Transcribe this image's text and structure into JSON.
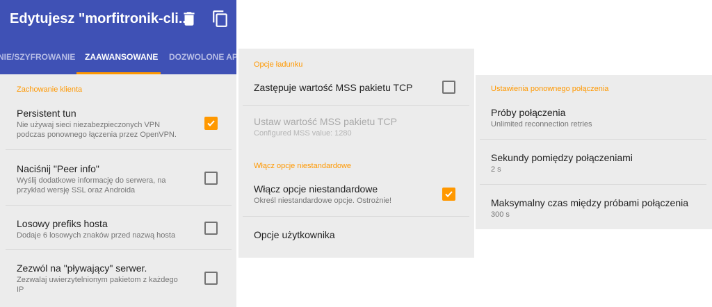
{
  "colors": {
    "primary": "#3f51b5",
    "accent": "#ff9800"
  },
  "panel1": {
    "app_title": "Edytujesz \"morfitronik-cli...",
    "icons": {
      "delete": "trash-icon",
      "duplicate": "copy-icon"
    },
    "tabs": [
      {
        "label": "NIE/SZYFROWANIE",
        "active": false
      },
      {
        "label": "ZAAWANSOWANE",
        "active": true
      },
      {
        "label": "DOZWOLONE APLIKACJE",
        "active": false
      }
    ],
    "section": "Zachowanie klienta",
    "items": [
      {
        "title": "Persistent tun",
        "summary": "Nie używaj sieci niezabezpieczonych VPN\npodczas ponownego łączenia przez OpenVPN.",
        "checked": true
      },
      {
        "title": "Naciśnij \"Peer info\"",
        "summary": "Wyślij dodatkowe informację do serwera, na\nprzykład wersję SSL oraz Androida",
        "checked": false
      },
      {
        "title": "Losowy prefiks hosta",
        "summary": "Dodaje 6 losowych znaków przed nazwą hosta",
        "checked": false
      },
      {
        "title": "Zezwól na \"pływający\" serwer.",
        "summary": "Zezwalaj uwierzytelnionym pakietom z każdego\nIP",
        "checked": false
      }
    ]
  },
  "panel2": {
    "section1": "Opcje ładunku",
    "mss_override": {
      "title": "Zastępuje wartość MSS pakietu TCP",
      "checked": false
    },
    "mss_value": {
      "title": "Ustaw wartość MSS pakietu TCP",
      "summary": "Configured MSS value: 1280"
    },
    "section2": "Włącz opcje niestandardowe",
    "custom_opts": {
      "title": "Włącz opcje niestandardowe",
      "summary": "Określ niestandardowe opcje. Ostrożnie!",
      "checked": true
    },
    "user_opts": {
      "title": "Opcje użytkownika"
    }
  },
  "panel3": {
    "section": "Ustawienia ponownego połączenia",
    "items": [
      {
        "title": "Próby połączenia",
        "summary": "Unlimited reconnection retries"
      },
      {
        "title": "Sekundy pomiędzy połączeniami",
        "summary": "2 s"
      },
      {
        "title": "Maksymalny czas między próbami połączenia",
        "summary": "300 s"
      }
    ]
  }
}
